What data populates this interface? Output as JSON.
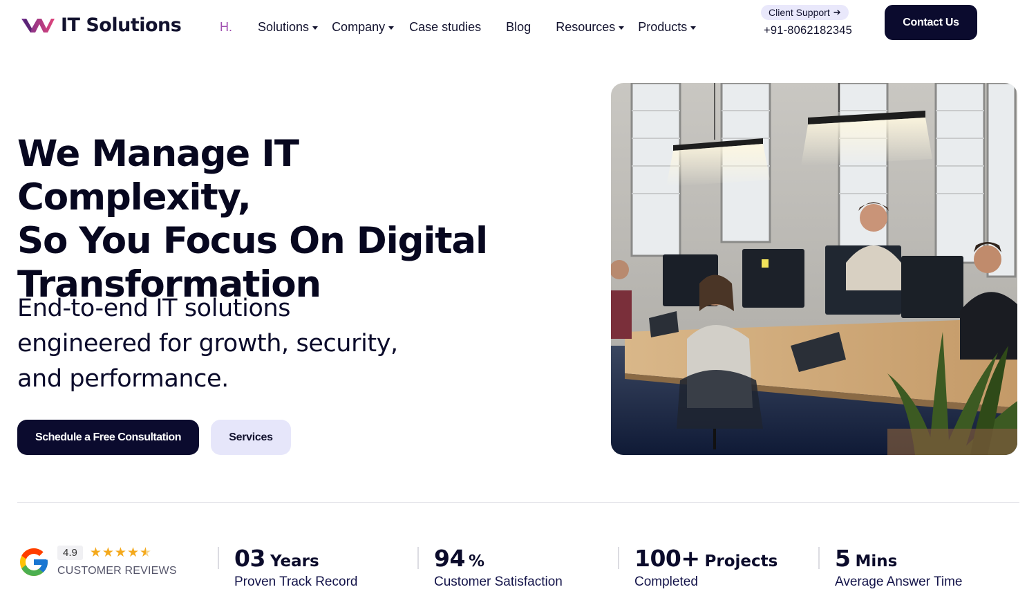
{
  "brand": {
    "name": "IT Solutions",
    "colors": {
      "primary": "#0b0b2e",
      "accent": "#a04fb0",
      "logo_purple": "#6b2d8c",
      "logo_pink": "#e0457b"
    }
  },
  "nav": {
    "items": [
      {
        "label": "H.",
        "dropdown": false,
        "active": true
      },
      {
        "label": "Solutions",
        "dropdown": true
      },
      {
        "label": "Company",
        "dropdown": true
      },
      {
        "label": "Case studies",
        "dropdown": false
      },
      {
        "label": "Blog",
        "dropdown": false
      },
      {
        "label": "Resources",
        "dropdown": true
      },
      {
        "label": "Products",
        "dropdown": true
      }
    ]
  },
  "support": {
    "label": "Client Support",
    "icon": "arrow-right-icon",
    "phone": "+91-8062182345"
  },
  "header": {
    "contact_label": "Contact Us"
  },
  "hero": {
    "title_lines": [
      "We Manage IT Complexity,",
      "So You Focus On Digital",
      "Transformation"
    ],
    "subtitle_lines": [
      "End-to-end IT solutions",
      "engineered for growth, security,",
      "and performance."
    ],
    "primary_cta": "Schedule a Free Consultation",
    "secondary_cta": "Services",
    "image": "office-team-photo"
  },
  "reviews": {
    "rating": "4.9",
    "stars": 4.5,
    "label": "CUSTOMER REVIEWS",
    "icon": "google-icon"
  },
  "stats": [
    {
      "value": "03",
      "unit": "Years",
      "label": "Proven Track Record"
    },
    {
      "value": "94",
      "unit": "%",
      "label": "Customer Satisfaction"
    },
    {
      "value": "100+",
      "unit": "Projects",
      "label": "Completed"
    },
    {
      "value": "5",
      "unit": "Mins",
      "label": "Average Answer Time"
    }
  ]
}
